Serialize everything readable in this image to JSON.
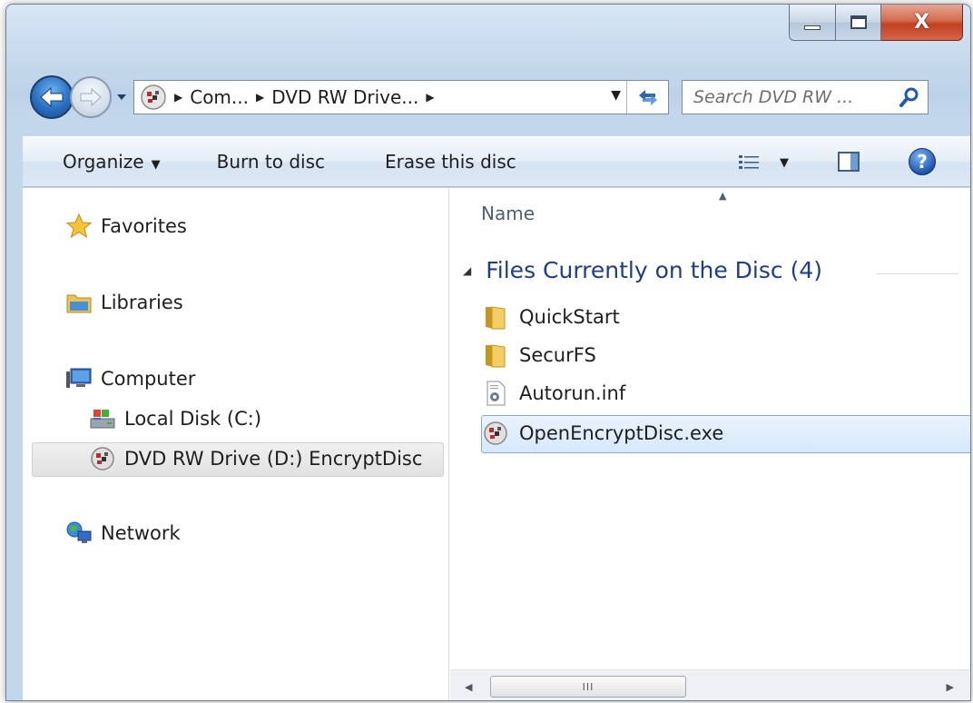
{
  "window": {
    "caption": {
      "close_glyph": "X"
    }
  },
  "address_bar": {
    "crumbs": [
      "Com...",
      "DVD RW Drive..."
    ]
  },
  "search": {
    "placeholder": "Search DVD RW ..."
  },
  "command_bar": {
    "organize": "Organize",
    "burn": "Burn to disc",
    "erase": "Erase this disc"
  },
  "help": {
    "label": "?"
  },
  "nav_pane": {
    "favorites": "Favorites",
    "libraries": "Libraries",
    "computer": "Computer",
    "local_disk": "Local Disk (C:)",
    "dvd_drive": "DVD RW Drive (D:) EncryptDisc",
    "network": "Network"
  },
  "file_list": {
    "column_name": "Name",
    "group_title": "Files Currently on the Disc (4)",
    "items": [
      {
        "name": "QuickStart",
        "icon": "folder-icon"
      },
      {
        "name": "SecurFS",
        "icon": "folder-icon"
      },
      {
        "name": "Autorun.inf",
        "icon": "settings-file-icon"
      },
      {
        "name": "OpenEncryptDisc.exe",
        "icon": "disc-app-icon",
        "selected": true
      }
    ]
  },
  "scrollbar": {
    "grip": "III"
  },
  "colors": {
    "group_title": "#1e3d8a",
    "selection_border": "#84acdd",
    "back_button": "#2a6fc0"
  }
}
